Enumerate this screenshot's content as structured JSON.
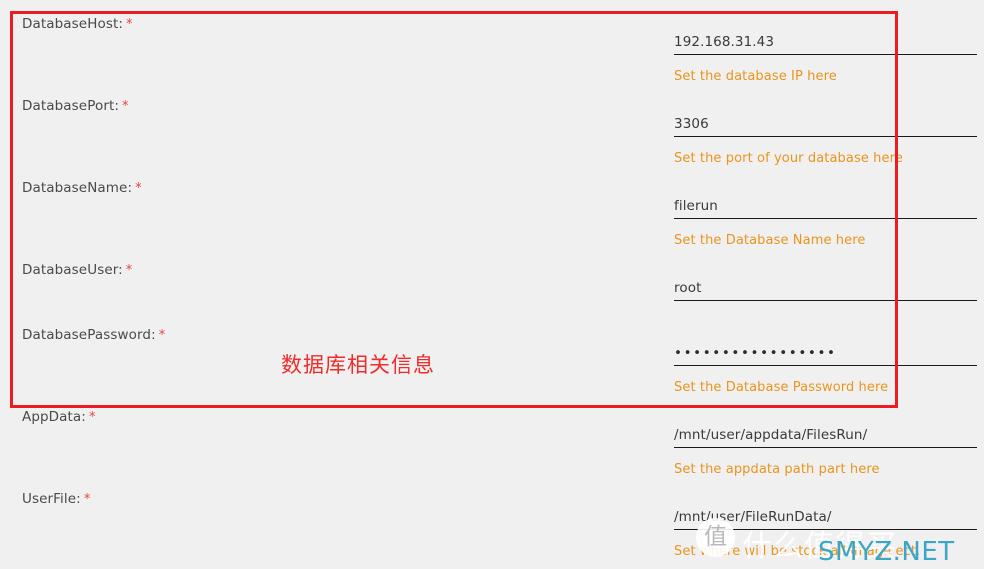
{
  "form": {
    "required_marker": "*",
    "fields": [
      {
        "label": "DatabaseHost:",
        "value": "192.168.31.43",
        "hint": "Set the database IP here",
        "type": "text"
      },
      {
        "label": "DatabasePort:",
        "value": "3306",
        "hint": "Set the port of your database here",
        "type": "text"
      },
      {
        "label": "DatabaseName:",
        "value": "filerun",
        "hint": "Set the Database Name here",
        "type": "text"
      },
      {
        "label": "DatabaseUser:",
        "value": "root",
        "hint": "",
        "type": "text"
      },
      {
        "label": "DatabasePassword:",
        "value": "•••••••••••••••••",
        "hint": "Set the Database Password here",
        "type": "password"
      },
      {
        "label": "AppData:",
        "value": "/mnt/user/appdata/FilesRun/",
        "hint": "Set the appdata path part here",
        "type": "text"
      },
      {
        "label": "UserFile:",
        "value": "/mnt/user/FileRunData/",
        "hint": "Set where will be stock all image ect.",
        "type": "text"
      }
    ]
  },
  "annotation": {
    "label": "数据库相关信息",
    "box_color": "#ec1c24",
    "text_color": "#ee2c2c"
  },
  "watermark": {
    "circle_glyph": "值",
    "chinese": "什么值得买",
    "domain": "SMYZ.NET",
    "domain_color": "#3aa7c8"
  },
  "colors": {
    "background": "#f0f0f0",
    "label_text": "#4a4a4a",
    "value_text": "#3a3a3a",
    "hint_text": "#e8951c",
    "required_star": "#e8453c",
    "underline": "#1a1a1a"
  }
}
